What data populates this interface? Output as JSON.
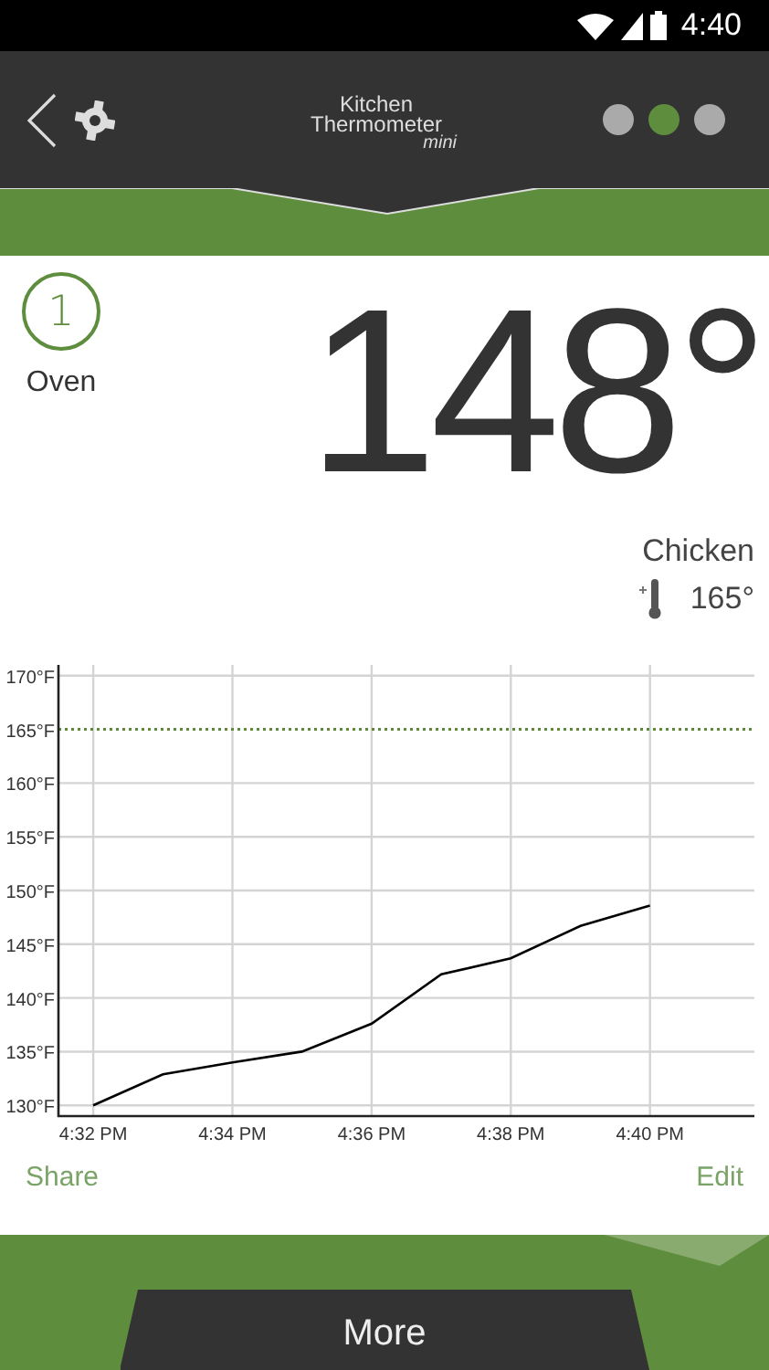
{
  "status_bar": {
    "time": "4:40"
  },
  "header": {
    "logo": {
      "line1": "Kitchen",
      "line2": "Thermometer",
      "line3": "mini"
    },
    "pages": [
      {
        "selected": false
      },
      {
        "selected": true
      },
      {
        "selected": false
      }
    ]
  },
  "probe": {
    "number": "1",
    "name": "Oven",
    "temperature": "148°",
    "food": "Chicken",
    "target": "165°"
  },
  "chart_data": {
    "type": "line",
    "categories": [
      "4:32 PM",
      null,
      "4:34 PM",
      null,
      "4:36 PM",
      null,
      "4:38 PM",
      null,
      "4:40 PM"
    ],
    "series": [
      {
        "color": "#000000",
        "values": [
          130,
          132.9,
          134,
          135,
          137.6,
          142.2,
          143.7,
          146.7,
          148.6
        ]
      }
    ],
    "ylim": [
      129,
      171
    ],
    "yticks": [
      {
        "value": 130,
        "label": "130°F"
      },
      {
        "value": 135,
        "label": "135°F"
      },
      {
        "value": 140,
        "label": "140°F"
      },
      {
        "value": 145,
        "label": "145°F"
      },
      {
        "value": 150,
        "label": "150°F"
      },
      {
        "value": 155,
        "label": "155°F"
      },
      {
        "value": 160,
        "label": "160°F"
      },
      {
        "value": 165,
        "label": "165°F"
      },
      {
        "value": 170,
        "label": "170°F"
      }
    ],
    "grid": true,
    "ref_lines": [
      {
        "axis": "y",
        "value": 165,
        "color": "#5c8a3a"
      }
    ]
  },
  "actions": {
    "share": "Share",
    "edit": "Edit"
  },
  "footer": {
    "button": "More"
  }
}
